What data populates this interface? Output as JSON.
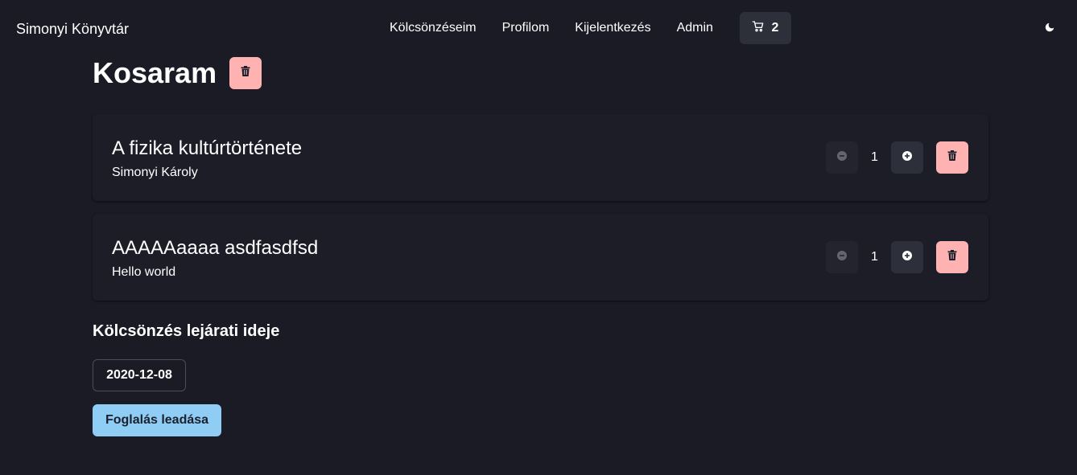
{
  "nav": {
    "brand": "Simonyi Könyvtár",
    "links": [
      "Kölcsönzéseim",
      "Profilom",
      "Kijelentkezés",
      "Admin"
    ],
    "cart_count": "2"
  },
  "page": {
    "title": "Kosaram"
  },
  "cart": {
    "items": [
      {
        "title": "A fizika kultúrtörténete",
        "author": "Simonyi Károly",
        "quantity": "1"
      },
      {
        "title": "AAAAAaaaa asdfasdfsd",
        "author": "Hello world",
        "quantity": "1"
      }
    ]
  },
  "due_date": {
    "label": "Kölcsönzés lejárati ideje",
    "value": "2020-12-08"
  },
  "submit": {
    "label": "Foglalás leadása"
  },
  "icons": {
    "cart": "cart-icon",
    "moon": "moon-icon",
    "trash": "trash-icon",
    "minus": "minus-circle-icon",
    "plus": "plus-circle-icon"
  },
  "colors": {
    "background": "#1a1b25",
    "danger": "#feb2b2",
    "primary": "#90cdf4",
    "button": "#2d2f3a"
  }
}
